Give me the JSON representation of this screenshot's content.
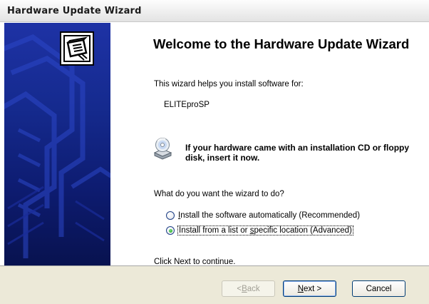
{
  "window": {
    "title": "Hardware Update Wizard"
  },
  "main": {
    "heading": "Welcome to the Hardware Update Wizard",
    "intro": "This wizard helps you install software for:",
    "device_name": "ELITEproSP",
    "cd_notice": "If your hardware came with an installation CD or floppy disk, insert it now.",
    "question": "What do you want the wizard to do?",
    "options": [
      {
        "label_access": "I",
        "label_rest": "nstall the software automatically (Recommended)",
        "selected": false
      },
      {
        "label_pre": "I",
        "label_mid1": "nstall from a list or ",
        "label_access": "s",
        "label_rest": "pecific location (Advanced)",
        "selected": true
      }
    ],
    "continue_hint": "Click Next to continue."
  },
  "buttons": {
    "back": {
      "pre": "< ",
      "access": "B",
      "rest": "ack",
      "enabled": false
    },
    "next": {
      "access": "N",
      "rest": "ext >",
      "enabled": true
    },
    "cancel": {
      "label": "Cancel",
      "enabled": true
    }
  },
  "icons": {
    "wizard_graphic": "hardware-wizard-icon",
    "cd": "cd-drive-icon"
  },
  "colors": {
    "panel_top": "#1e32a5",
    "panel_bottom": "#08124f",
    "radio_selected": "#179e17"
  }
}
